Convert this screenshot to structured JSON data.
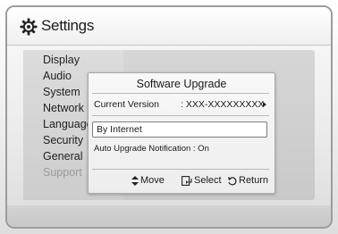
{
  "header": {
    "title": "Settings",
    "icon": "gear-icon"
  },
  "menu": {
    "items": [
      {
        "label": "Display",
        "enabled": true
      },
      {
        "label": "Audio",
        "enabled": true
      },
      {
        "label": "System",
        "enabled": true
      },
      {
        "label": "Network",
        "enabled": true
      },
      {
        "label": "Language",
        "enabled": true
      },
      {
        "label": "Security",
        "enabled": true
      },
      {
        "label": "General",
        "enabled": true
      },
      {
        "label": "Support",
        "enabled": false
      }
    ]
  },
  "dialog": {
    "title": "Software Upgrade",
    "current_version_label": "Current Version",
    "current_version_value": ": XXX-XXXXXXXXX",
    "options": {
      "by_internet": "By Internet",
      "auto_upgrade_label": "Auto Upgrade Notification",
      "auto_upgrade_value": ": On"
    },
    "footer": {
      "move": "Move",
      "select": "Select",
      "return": "Return"
    }
  }
}
